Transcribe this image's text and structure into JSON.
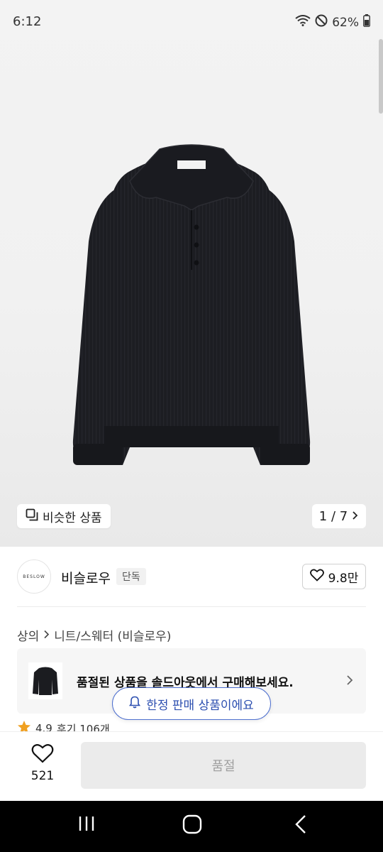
{
  "status_bar": {
    "time": "6:12",
    "battery": "62%"
  },
  "gallery": {
    "similar_label": "비슷한 상품",
    "counter": "1 / 7"
  },
  "brand": {
    "logo_text": "BESLOW",
    "name": "비슬로우",
    "badge": "단독",
    "likes": "9.8만"
  },
  "breadcrumb": {
    "category": "상의",
    "sub": "니트/스웨터 (비슬로우)"
  },
  "soldout_card": {
    "message": "품절된 상품을 솔드아웃에서 구매해보세요."
  },
  "rating": {
    "score": "4.9",
    "reviews": "후기 106개"
  },
  "toast": {
    "message": "한정 판매 상품이에요"
  },
  "action_bar": {
    "wish_count": "521",
    "buy_label": "품절"
  },
  "colors": {
    "accent": "#2c4fb0",
    "garment": "#1b1c20",
    "star": "#f0a020"
  }
}
